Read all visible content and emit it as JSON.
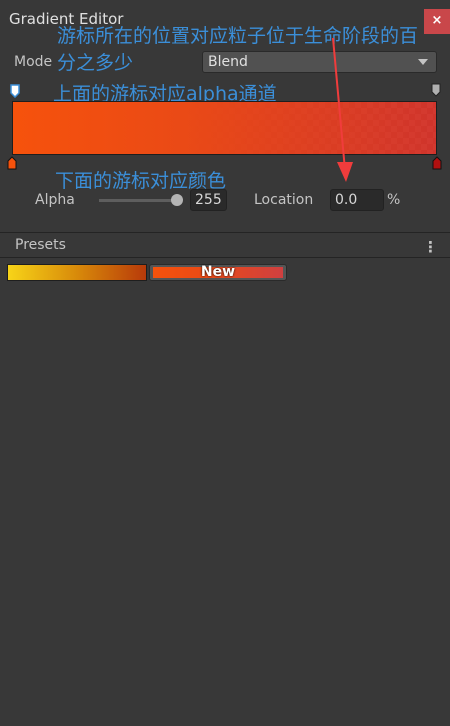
{
  "window": {
    "title": "Gradient Editor",
    "close_label": "×"
  },
  "annotations": {
    "location_note_line1": "游标所在的位置对应粒子位于生命阶段的百",
    "location_note_line2": "分之多少",
    "alpha_note": "上面的游标对应alpha通道",
    "color_note": "下面的游标对应颜色",
    "arrow_color": "#f03c3c",
    "text_color": "#3b8fd9"
  },
  "mode": {
    "label": "Mode",
    "value": "Blend"
  },
  "gradient": {
    "start_color": "#f6520c",
    "end_color": "#d04040"
  },
  "alpha": {
    "label": "Alpha",
    "value": "255",
    "slider_fraction": 1.0
  },
  "location": {
    "label": "Location",
    "value": "0.0",
    "unit": "%"
  },
  "presets": {
    "title": "Presets",
    "menu_icon": "kebab-icon",
    "items": [
      {
        "name": "yellow-red"
      },
      {
        "label": "New"
      }
    ]
  }
}
